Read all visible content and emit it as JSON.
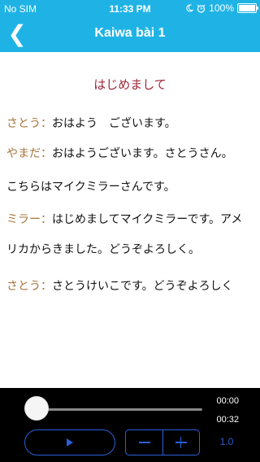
{
  "status": {
    "carrier": "No SIM",
    "time": "11:33 PM",
    "battery_pct": "100%",
    "icons": [
      "moon-icon",
      "alarm-icon",
      "battery-icon"
    ]
  },
  "nav": {
    "back_glyph": "❮",
    "title": "Kaiwa bài 1"
  },
  "lesson": {
    "title": "はじめまして",
    "lines": [
      {
        "speaker": "さとう：",
        "text": "おはよう　ございます。"
      },
      {
        "speaker": "やまだ：",
        "text": "おはようございます。さとうさん。"
      },
      {
        "speaker": "",
        "text": "こちらはマイクミラーさんです。"
      },
      {
        "speaker": "ミラー：",
        "text": "はじめましてマイクミラーです。アメ"
      },
      {
        "speaker": "",
        "text": "リカからきました。どうぞよろしく。"
      },
      {
        "speaker": "さとう：",
        "text": "さとうけいこです。どうぞよろしく"
      }
    ]
  },
  "player": {
    "elapsed": "00:00",
    "total": "00:32",
    "progress": 0.0,
    "speed": "1.0",
    "play_icon": "play-icon",
    "minus_icon": "minus-icon",
    "plus_icon": "plus-icon"
  },
  "colors": {
    "header": "#1fb3e5",
    "lesson_title": "#a0283a",
    "speaker": "#a8733a",
    "accent": "#2a5fd8"
  }
}
